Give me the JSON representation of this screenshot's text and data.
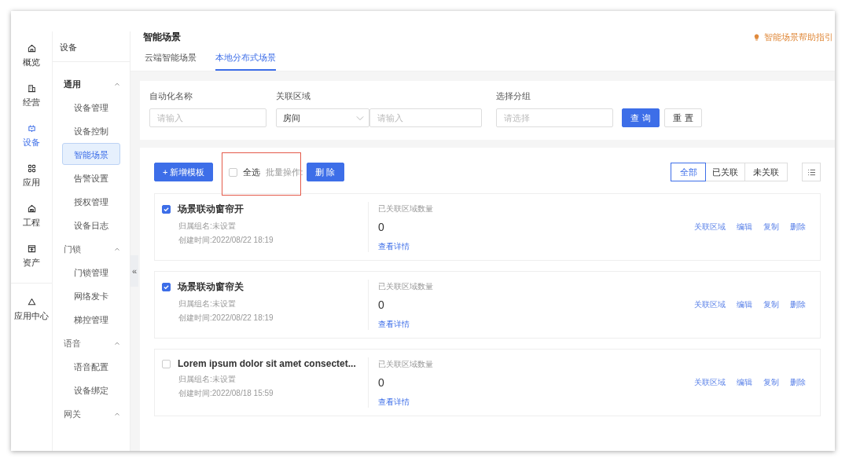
{
  "rail": {
    "items": [
      {
        "label": "概览",
        "selected": false
      },
      {
        "label": "经营",
        "selected": false
      },
      {
        "label": "设备",
        "selected": true
      },
      {
        "label": "应用",
        "selected": false
      },
      {
        "label": "工程",
        "selected": false
      },
      {
        "label": "资产",
        "selected": false
      }
    ],
    "bottom": {
      "label": "应用中心",
      "selected": false
    }
  },
  "sidebar": {
    "title": "设备",
    "groups": [
      {
        "label": "通用",
        "expanded": true,
        "items": [
          {
            "label": "设备管理",
            "selected": false
          },
          {
            "label": "设备控制",
            "selected": false
          },
          {
            "label": "智能场景",
            "selected": true
          },
          {
            "label": "告警设置",
            "selected": false
          },
          {
            "label": "授权管理",
            "selected": false
          },
          {
            "label": "设备日志",
            "selected": false
          }
        ]
      },
      {
        "label": "门锁",
        "expanded": true,
        "items": [
          {
            "label": "门锁管理",
            "selected": false
          },
          {
            "label": "网络发卡",
            "selected": false
          },
          {
            "label": "梯控管理",
            "selected": false
          }
        ]
      },
      {
        "label": "语音",
        "expanded": true,
        "items": [
          {
            "label": "语音配置",
            "selected": false
          },
          {
            "label": "设备绑定",
            "selected": false
          }
        ]
      },
      {
        "label": "网关",
        "expanded": true
      }
    ],
    "collapse": "«"
  },
  "header": {
    "title": "智能场景",
    "help_link": "智能场景帮助指引",
    "tabs": [
      {
        "label": "云端智能场景",
        "selected": false
      },
      {
        "label": "本地分布式场景",
        "selected": true
      }
    ]
  },
  "filters": {
    "fields": [
      {
        "label": "自动化名称",
        "placeholder": "请输入"
      },
      {
        "label": "关联区域",
        "select_value": "房间",
        "placeholder": "请输入"
      },
      {
        "label": "选择分组",
        "placeholder": "请选择"
      }
    ],
    "query_button": "查 询",
    "reset_button": "重 置"
  },
  "toolbar": {
    "add_button": "+ 新增模板",
    "select_all": {
      "label": "全选",
      "checked": false
    },
    "batch_label": "批量操作:",
    "delete_button": "删 除",
    "segments": [
      {
        "label": "全部",
        "selected": true
      },
      {
        "label": "已关联",
        "selected": false
      },
      {
        "label": "未关联",
        "selected": false
      }
    ]
  },
  "scenes": [
    {
      "name": "场景联动窗帘开",
      "checked": true,
      "group": "归属组名:未设置",
      "created": "创建时间:2022/08/22 18:19",
      "count_label": "已关联区域数量",
      "count": "0",
      "detail_link": "查看详情",
      "actions": [
        "关联区域",
        "编辑",
        "复制",
        "删除"
      ]
    },
    {
      "name": "场景联动窗帘关",
      "checked": true,
      "group": "归属组名:未设置",
      "created": "创建时间:2022/08/22 18:19",
      "count_label": "已关联区域数量",
      "count": "0",
      "detail_link": "查看详情",
      "actions": [
        "关联区域",
        "编辑",
        "复制",
        "删除"
      ]
    },
    {
      "name": "Lorem ipsum dolor sit amet consectet...",
      "checked": false,
      "group": "归属组名:未设置",
      "created": "创建时间:2022/08/18 15:59",
      "count_label": "已关联区域数量",
      "count": "0",
      "detail_link": "查看详情",
      "actions": [
        "关联区域",
        "编辑",
        "复制",
        "删除"
      ]
    }
  ]
}
